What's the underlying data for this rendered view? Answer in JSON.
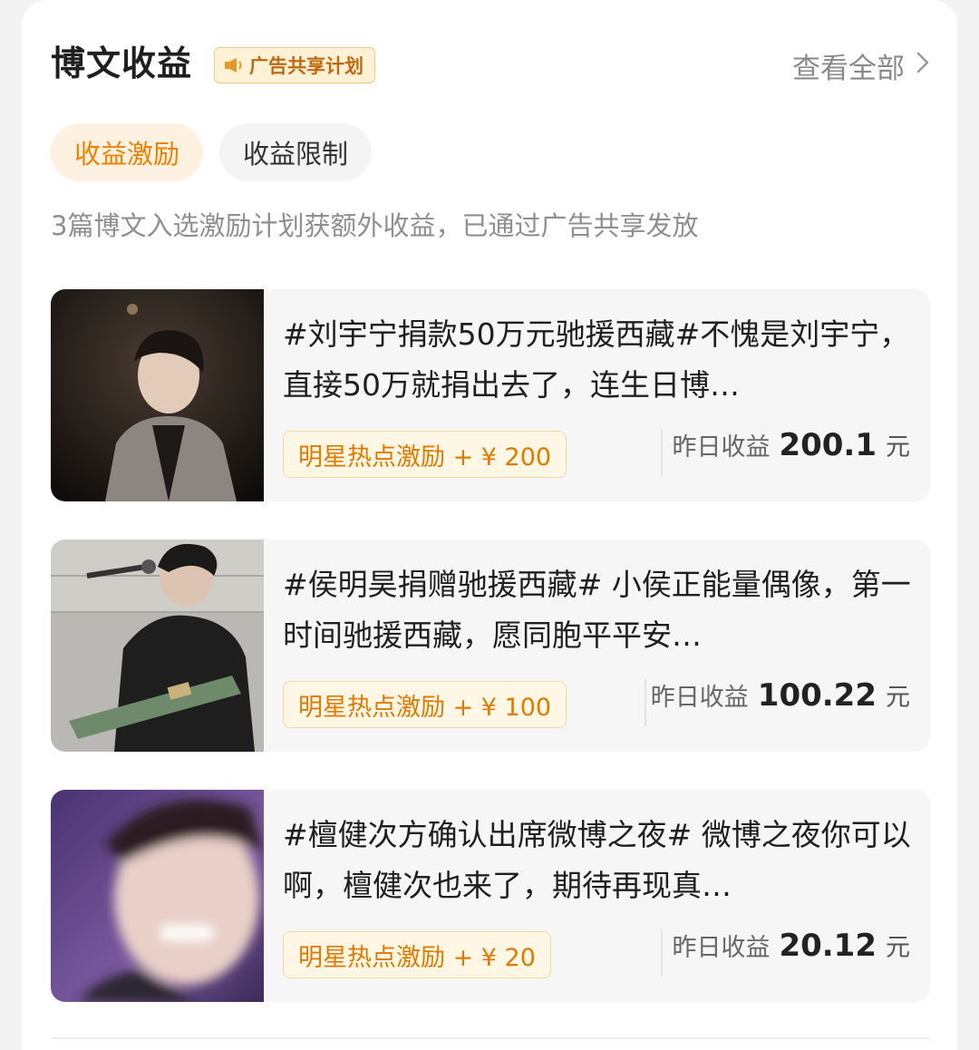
{
  "section": {
    "title": "博文收益",
    "ad_badge_label": "广告共享计划",
    "view_all_label": "查看全部"
  },
  "tabs": [
    {
      "label": "收益激励",
      "active": true
    },
    {
      "label": "收益限制",
      "active": false
    }
  ],
  "description": "3篇博文入选激励计划获额外收益，已通过广告共享发放",
  "posts": [
    {
      "text": "#刘宇宁捐款50万元驰援西藏#不愧是刘宇宁，直接50万就捐出去了，连生日博…",
      "incentive": "明星热点激励 + ¥ 200",
      "earn_label": "昨日收益",
      "earn_value": "200.1",
      "earn_unit": "元"
    },
    {
      "text": "#侯明昊捐赠驰援西藏# 小侯正能量偶像，第一时间驰援西藏，愿同胞平平安…",
      "incentive": "明星热点激励 + ¥ 100",
      "earn_label": "昨日收益",
      "earn_value": "100.22",
      "earn_unit": "元"
    },
    {
      "text": "#檀健次方确认出席微博之夜# 微博之夜你可以啊，檀健次也来了，期待再现真…",
      "incentive": "明星热点激励 + ¥ 20",
      "earn_label": "昨日收益",
      "earn_value": "20.12",
      "earn_unit": "元"
    }
  ],
  "colors": {
    "accent": "#f08200",
    "badge_bg": "#fff1d6",
    "incentive_bg": "#fff7e6",
    "card_bg": "#f6f6f6"
  }
}
